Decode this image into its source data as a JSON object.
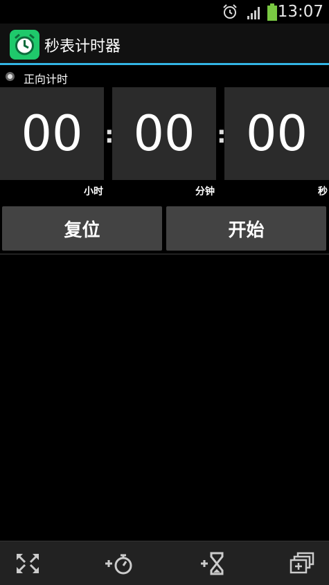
{
  "status_bar": {
    "time": "13:07",
    "icons": [
      "alarm-icon",
      "signal-icon",
      "battery-icon"
    ]
  },
  "header": {
    "app_icon": "alarm-clock-icon",
    "title": "秒表计时器"
  },
  "mode": {
    "label": "正向计时"
  },
  "timer": {
    "hours": "00",
    "minutes": "00",
    "seconds": "00",
    "separator": ":",
    "units": {
      "hours": "小时",
      "minutes": "分钟",
      "seconds": "秒"
    }
  },
  "buttons": {
    "reset": "复位",
    "start": "开始"
  },
  "bottom_bar": {
    "icons": [
      "fullscreen-icon",
      "add-stopwatch-icon",
      "add-timer-icon",
      "windows-icon"
    ]
  },
  "colors": {
    "accent": "#33b5e5",
    "app_icon_bg": "#1fc96b",
    "digit_bg": "#2b2b2b",
    "button_bg": "#434343"
  }
}
